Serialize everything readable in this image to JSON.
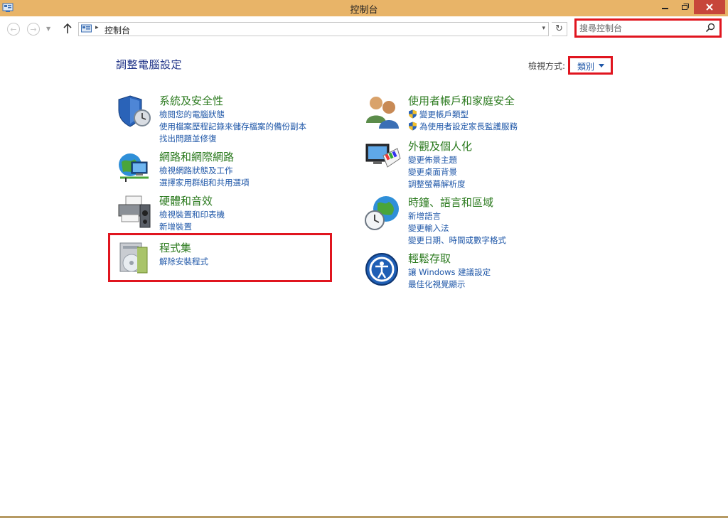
{
  "window": {
    "title": "控制台"
  },
  "address": {
    "path": "控制台",
    "separator": "▸"
  },
  "search": {
    "placeholder": "搜尋控制台"
  },
  "main": {
    "heading": "調整電腦設定",
    "view_by_label": "檢視方式:",
    "view_by_value": "類別"
  },
  "categories": {
    "system": {
      "title": "系統及安全性",
      "icon": "shield-clock-icon",
      "links": [
        "檢閱您的電腦狀態",
        "使用檔案歷程記錄來儲存檔案的備份副本",
        "找出問題並修復"
      ]
    },
    "network": {
      "title": "網路和網際網路",
      "icon": "network-globe-icon",
      "links": [
        "檢視網路狀態及工作",
        "選擇家用群組和共用選項"
      ]
    },
    "hardware": {
      "title": "硬體和音效",
      "icon": "printer-speaker-icon",
      "links": [
        "檢視裝置和印表機",
        "新增裝置"
      ]
    },
    "programs": {
      "title": "程式集",
      "icon": "programs-disc-icon",
      "links": [
        "解除安裝程式"
      ]
    },
    "users": {
      "title": "使用者帳戶和家庭安全",
      "icon": "users-icon",
      "links": [
        "變更帳戶類型",
        "為使用者設定家長監護服務"
      ]
    },
    "appearance": {
      "title": "外觀及個人化",
      "icon": "monitor-palette-icon",
      "links": [
        "變更佈景主題",
        "變更桌面背景",
        "調整螢幕解析度"
      ]
    },
    "clock": {
      "title": "時鐘、語言和區域",
      "icon": "globe-clock-icon",
      "links": [
        "新增語言",
        "變更輸入法",
        "變更日期、時間或數字格式"
      ]
    },
    "ease": {
      "title": "輕鬆存取",
      "icon": "ease-of-access-icon",
      "links": [
        "讓 Windows 建議設定",
        "最佳化視覺顯示"
      ]
    }
  },
  "colors": {
    "titlebar": "#e8b468",
    "close_button": "#c7463a",
    "category_title": "#2b7a1e",
    "link": "#1f57a8",
    "highlight": "#e0151f"
  }
}
